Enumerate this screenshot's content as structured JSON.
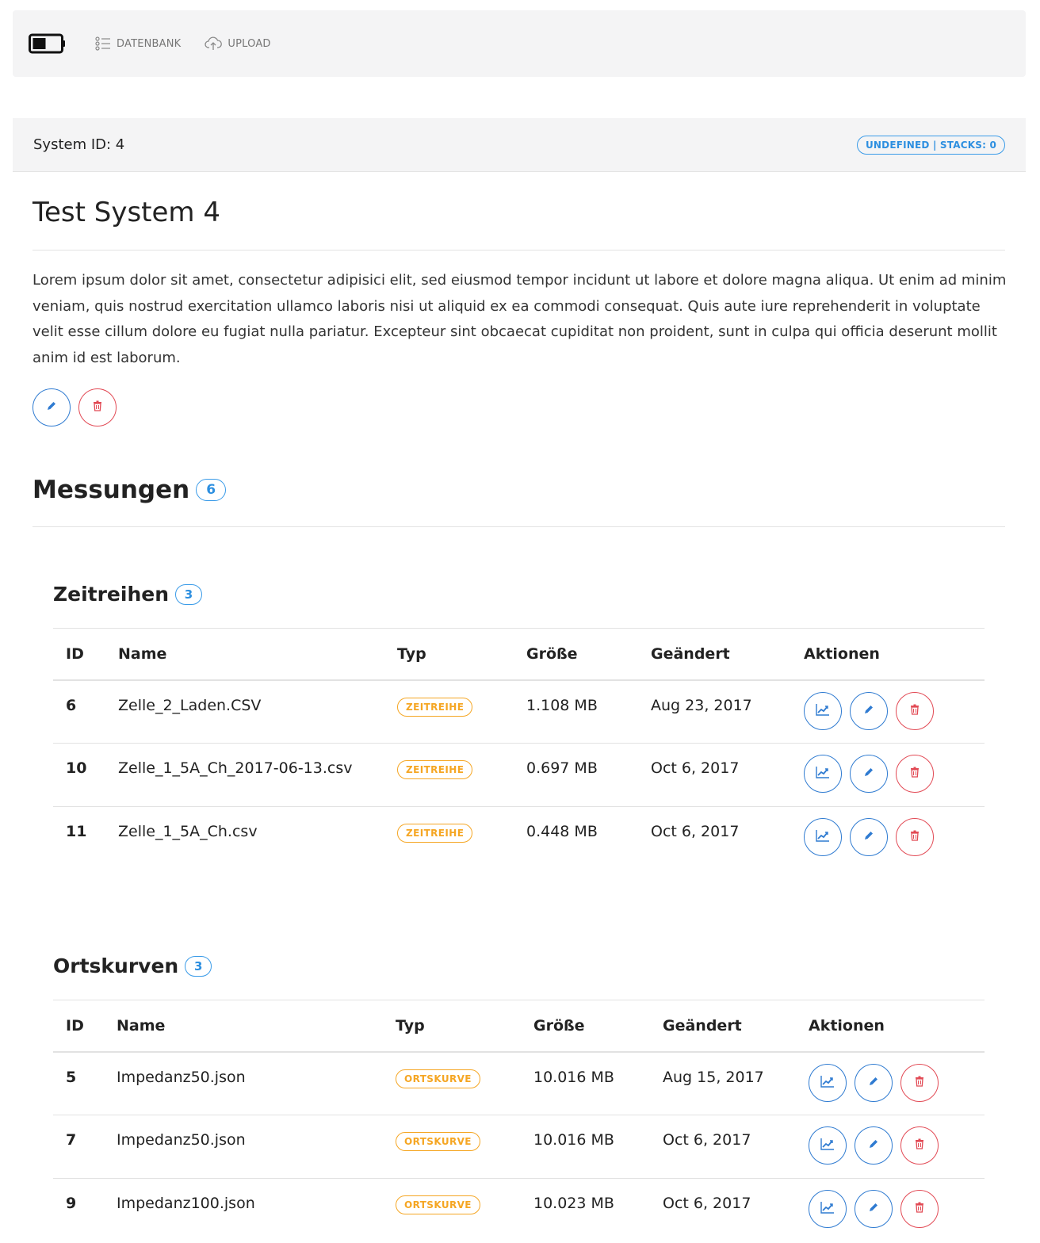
{
  "nav": {
    "items": [
      {
        "label": "DATENBANK",
        "icon": "list-icon"
      },
      {
        "label": "UPLOAD",
        "icon": "cloud-upload-icon"
      }
    ]
  },
  "system": {
    "id_label": "System ID: 4",
    "badge": "UNDEFINED | STACKS: 0",
    "title": "Test System 4",
    "description": "Lorem ipsum dolor sit amet, consectetur adipisici elit, sed eiusmod tempor incidunt ut labore et dolore magna aliqua. Ut enim ad minim veniam, quis nostrud exercitation ullamco laboris nisi ut aliquid ex ea commodi consequat. Quis aute iure reprehenderit in voluptate velit esse cillum dolore eu fugiat nulla pariatur. Excepteur sint obcaecat cupiditat non proident, sunt in culpa qui officia deserunt mollit anim id est laborum."
  },
  "measurements": {
    "title": "Messungen",
    "count": "6"
  },
  "columns": {
    "id": "ID",
    "name": "Name",
    "type": "Typ",
    "size": "Größe",
    "changed": "Geändert",
    "actions": "Aktionen"
  },
  "zeitreihen": {
    "title": "Zeitreihen",
    "count": "3",
    "rows": [
      {
        "id": "6",
        "name": "Zelle_2_Laden.CSV",
        "type": "ZEITREIHE",
        "size": "1.108 MB",
        "changed": "Aug 23, 2017"
      },
      {
        "id": "10",
        "name": "Zelle_1_5A_Ch_2017-06-13.csv",
        "type": "ZEITREIHE",
        "size": "0.697 MB",
        "changed": "Oct 6, 2017"
      },
      {
        "id": "11",
        "name": "Zelle_1_5A_Ch.csv",
        "type": "ZEITREIHE",
        "size": "0.448 MB",
        "changed": "Oct 6, 2017"
      }
    ]
  },
  "ortskurven": {
    "title": "Ortskurven",
    "count": "3",
    "rows": [
      {
        "id": "5",
        "name": "Impedanz50.json",
        "type": "ORTSKURVE",
        "size": "10.016 MB",
        "changed": "Aug 15, 2017"
      },
      {
        "id": "7",
        "name": "Impedanz50.json",
        "type": "ORTSKURVE",
        "size": "10.016 MB",
        "changed": "Oct 6, 2017"
      },
      {
        "id": "9",
        "name": "Impedanz100.json",
        "type": "ORTSKURVE",
        "size": "10.023 MB",
        "changed": "Oct 6, 2017"
      }
    ]
  },
  "colors": {
    "primary": "#2f7bd1",
    "info": "#3a9be8",
    "danger": "#e24a55",
    "warning": "#f5a623"
  }
}
